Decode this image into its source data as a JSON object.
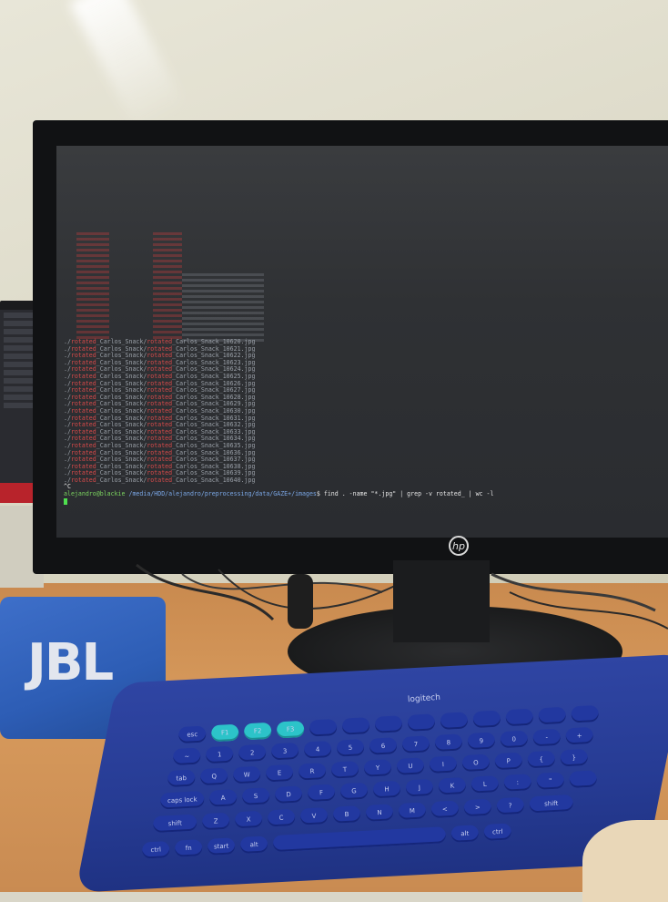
{
  "scene": {
    "description_colors": {
      "wall": "#dcd9c7",
      "desk": "#d79a5c",
      "speaker": "#2d5db5",
      "keyboard": "#263b93",
      "terminal_bg": "#2f3134",
      "prompt_green": "#7bd35f",
      "path_blue": "#7aa7e6",
      "highlight_red": "#d84a4a"
    }
  },
  "monitor": {
    "brand": "hp"
  },
  "terminal": {
    "file_lines": [
      {
        "prefix": "./",
        "dir": "rotated",
        "mid": "_Carlos_Snack/",
        "dir2": "rotated",
        "file": "_Carlos_Snack_10620.jpg"
      },
      {
        "prefix": "./",
        "dir": "rotated",
        "mid": "_Carlos_Snack/",
        "dir2": "rotated",
        "file": "_Carlos_Snack_10621.jpg"
      },
      {
        "prefix": "./",
        "dir": "rotated",
        "mid": "_Carlos_Snack/",
        "dir2": "rotated",
        "file": "_Carlos_Snack_10622.jpg"
      },
      {
        "prefix": "./",
        "dir": "rotated",
        "mid": "_Carlos_Snack/",
        "dir2": "rotated",
        "file": "_Carlos_Snack_10623.jpg"
      },
      {
        "prefix": "./",
        "dir": "rotated",
        "mid": "_Carlos_Snack/",
        "dir2": "rotated",
        "file": "_Carlos_Snack_10624.jpg"
      },
      {
        "prefix": "./",
        "dir": "rotated",
        "mid": "_Carlos_Snack/",
        "dir2": "rotated",
        "file": "_Carlos_Snack_10625.jpg"
      },
      {
        "prefix": "./",
        "dir": "rotated",
        "mid": "_Carlos_Snack/",
        "dir2": "rotated",
        "file": "_Carlos_Snack_10626.jpg"
      },
      {
        "prefix": "./",
        "dir": "rotated",
        "mid": "_Carlos_Snack/",
        "dir2": "rotated",
        "file": "_Carlos_Snack_10627.jpg"
      },
      {
        "prefix": "./",
        "dir": "rotated",
        "mid": "_Carlos_Snack/",
        "dir2": "rotated",
        "file": "_Carlos_Snack_10628.jpg"
      },
      {
        "prefix": "./",
        "dir": "rotated",
        "mid": "_Carlos_Snack/",
        "dir2": "rotated",
        "file": "_Carlos_Snack_10629.jpg"
      },
      {
        "prefix": "./",
        "dir": "rotated",
        "mid": "_Carlos_Snack/",
        "dir2": "rotated",
        "file": "_Carlos_Snack_10630.jpg"
      },
      {
        "prefix": "./",
        "dir": "rotated",
        "mid": "_Carlos_Snack/",
        "dir2": "rotated",
        "file": "_Carlos_Snack_10631.jpg"
      },
      {
        "prefix": "./",
        "dir": "rotated",
        "mid": "_Carlos_Snack/",
        "dir2": "rotated",
        "file": "_Carlos_Snack_10632.jpg"
      },
      {
        "prefix": "./",
        "dir": "rotated",
        "mid": "_Carlos_Snack/",
        "dir2": "rotated",
        "file": "_Carlos_Snack_10633.jpg"
      },
      {
        "prefix": "./",
        "dir": "rotated",
        "mid": "_Carlos_Snack/",
        "dir2": "rotated",
        "file": "_Carlos_Snack_10634.jpg"
      },
      {
        "prefix": "./",
        "dir": "rotated",
        "mid": "_Carlos_Snack/",
        "dir2": "rotated",
        "file": "_Carlos_Snack_10635.jpg"
      },
      {
        "prefix": "./",
        "dir": "rotated",
        "mid": "_Carlos_Snack/",
        "dir2": "rotated",
        "file": "_Carlos_Snack_10636.jpg"
      },
      {
        "prefix": "./",
        "dir": "rotated",
        "mid": "_Carlos_Snack/",
        "dir2": "rotated",
        "file": "_Carlos_Snack_10637.jpg"
      },
      {
        "prefix": "./",
        "dir": "rotated",
        "mid": "_Carlos_Snack/",
        "dir2": "rotated",
        "file": "_Carlos_Snack_10638.jpg"
      },
      {
        "prefix": "./",
        "dir": "rotated",
        "mid": "_Carlos_Snack/",
        "dir2": "rotated",
        "file": "_Carlos_Snack_10639.jpg"
      },
      {
        "prefix": "./",
        "dir": "rotated",
        "mid": "_Carlos_Snack/",
        "dir2": "rotated",
        "file": "_Carlos_Snack_10640.jpg"
      }
    ],
    "interrupt": "^C",
    "prompt_user": "alejandro@blackie",
    "prompt_path": " /media/HDD/alejandro/preprocessing/data/GAZE+/images",
    "prompt_symbol": "$ ",
    "command": "find . -name \"*.jpg\" | grep -v rotated_ | wc -l"
  },
  "speaker": {
    "brand": "JBL"
  },
  "keyboard": {
    "brand": "logitech",
    "rows": [
      [
        "esc",
        "F1",
        "F2",
        "F3",
        "",
        "",
        "",
        "",
        "",
        "",
        "",
        "",
        ""
      ],
      [
        "~",
        "1",
        "2",
        "3",
        "4",
        "5",
        "6",
        "7",
        "8",
        "9",
        "0",
        "-",
        "+"
      ],
      [
        "tab",
        "Q",
        "W",
        "E",
        "R",
        "T",
        "Y",
        "U",
        "I",
        "O",
        "P",
        "{",
        "}"
      ],
      [
        "caps lock",
        "A",
        "S",
        "D",
        "F",
        "G",
        "H",
        "J",
        "K",
        "L",
        ":",
        "\"",
        ""
      ],
      [
        "shift",
        "Z",
        "X",
        "C",
        "V",
        "B",
        "N",
        "M",
        "<",
        ">",
        "?",
        "shift"
      ],
      [
        "ctrl",
        "fn",
        "start",
        "alt",
        "",
        "alt",
        "ctrl"
      ]
    ]
  }
}
